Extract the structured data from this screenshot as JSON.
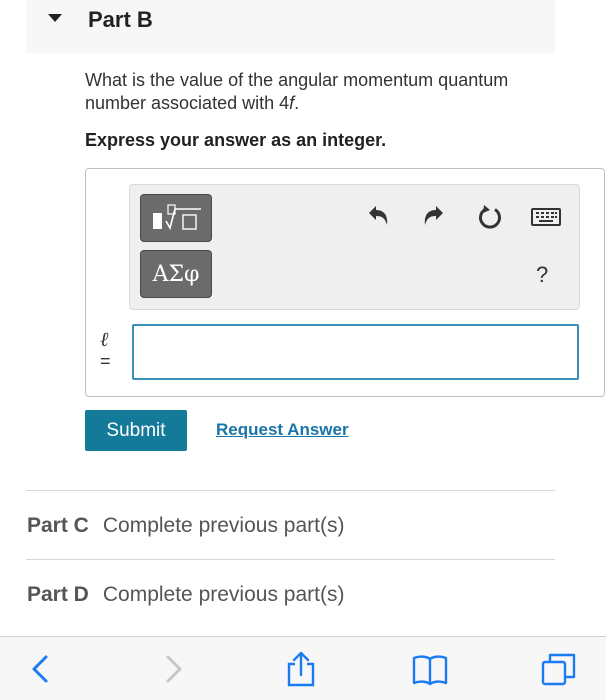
{
  "part_b": {
    "title": "Part B",
    "question_prefix": "What is the value of the angular momentum quantum number associated with 4",
    "question_italic": "f",
    "question_suffix": ".",
    "instruction": "Express your answer as an integer.",
    "greek_button_label": "ΑΣφ",
    "help_label": "?",
    "variable_symbol": "ℓ",
    "variable_equals": "=",
    "answer_value": "",
    "submit_label": "Submit",
    "request_answer_label": "Request Answer",
    "toolbar_icons": [
      "templates-icon",
      "undo-icon",
      "redo-icon",
      "reset-icon",
      "keyboard-icon"
    ]
  },
  "other_parts": [
    {
      "name": "Part C",
      "status": "Complete previous part(s)"
    },
    {
      "name": "Part D",
      "status": "Complete previous part(s)"
    }
  ],
  "browser_bar": {
    "icons": [
      "back-icon",
      "forward-icon",
      "share-icon",
      "bookmarks-icon",
      "tabs-icon"
    ]
  },
  "colors": {
    "accent": "#137b99",
    "link": "#1b75a6",
    "input_border": "#3a8fb7",
    "ios_blue": "#1a7cf0"
  }
}
